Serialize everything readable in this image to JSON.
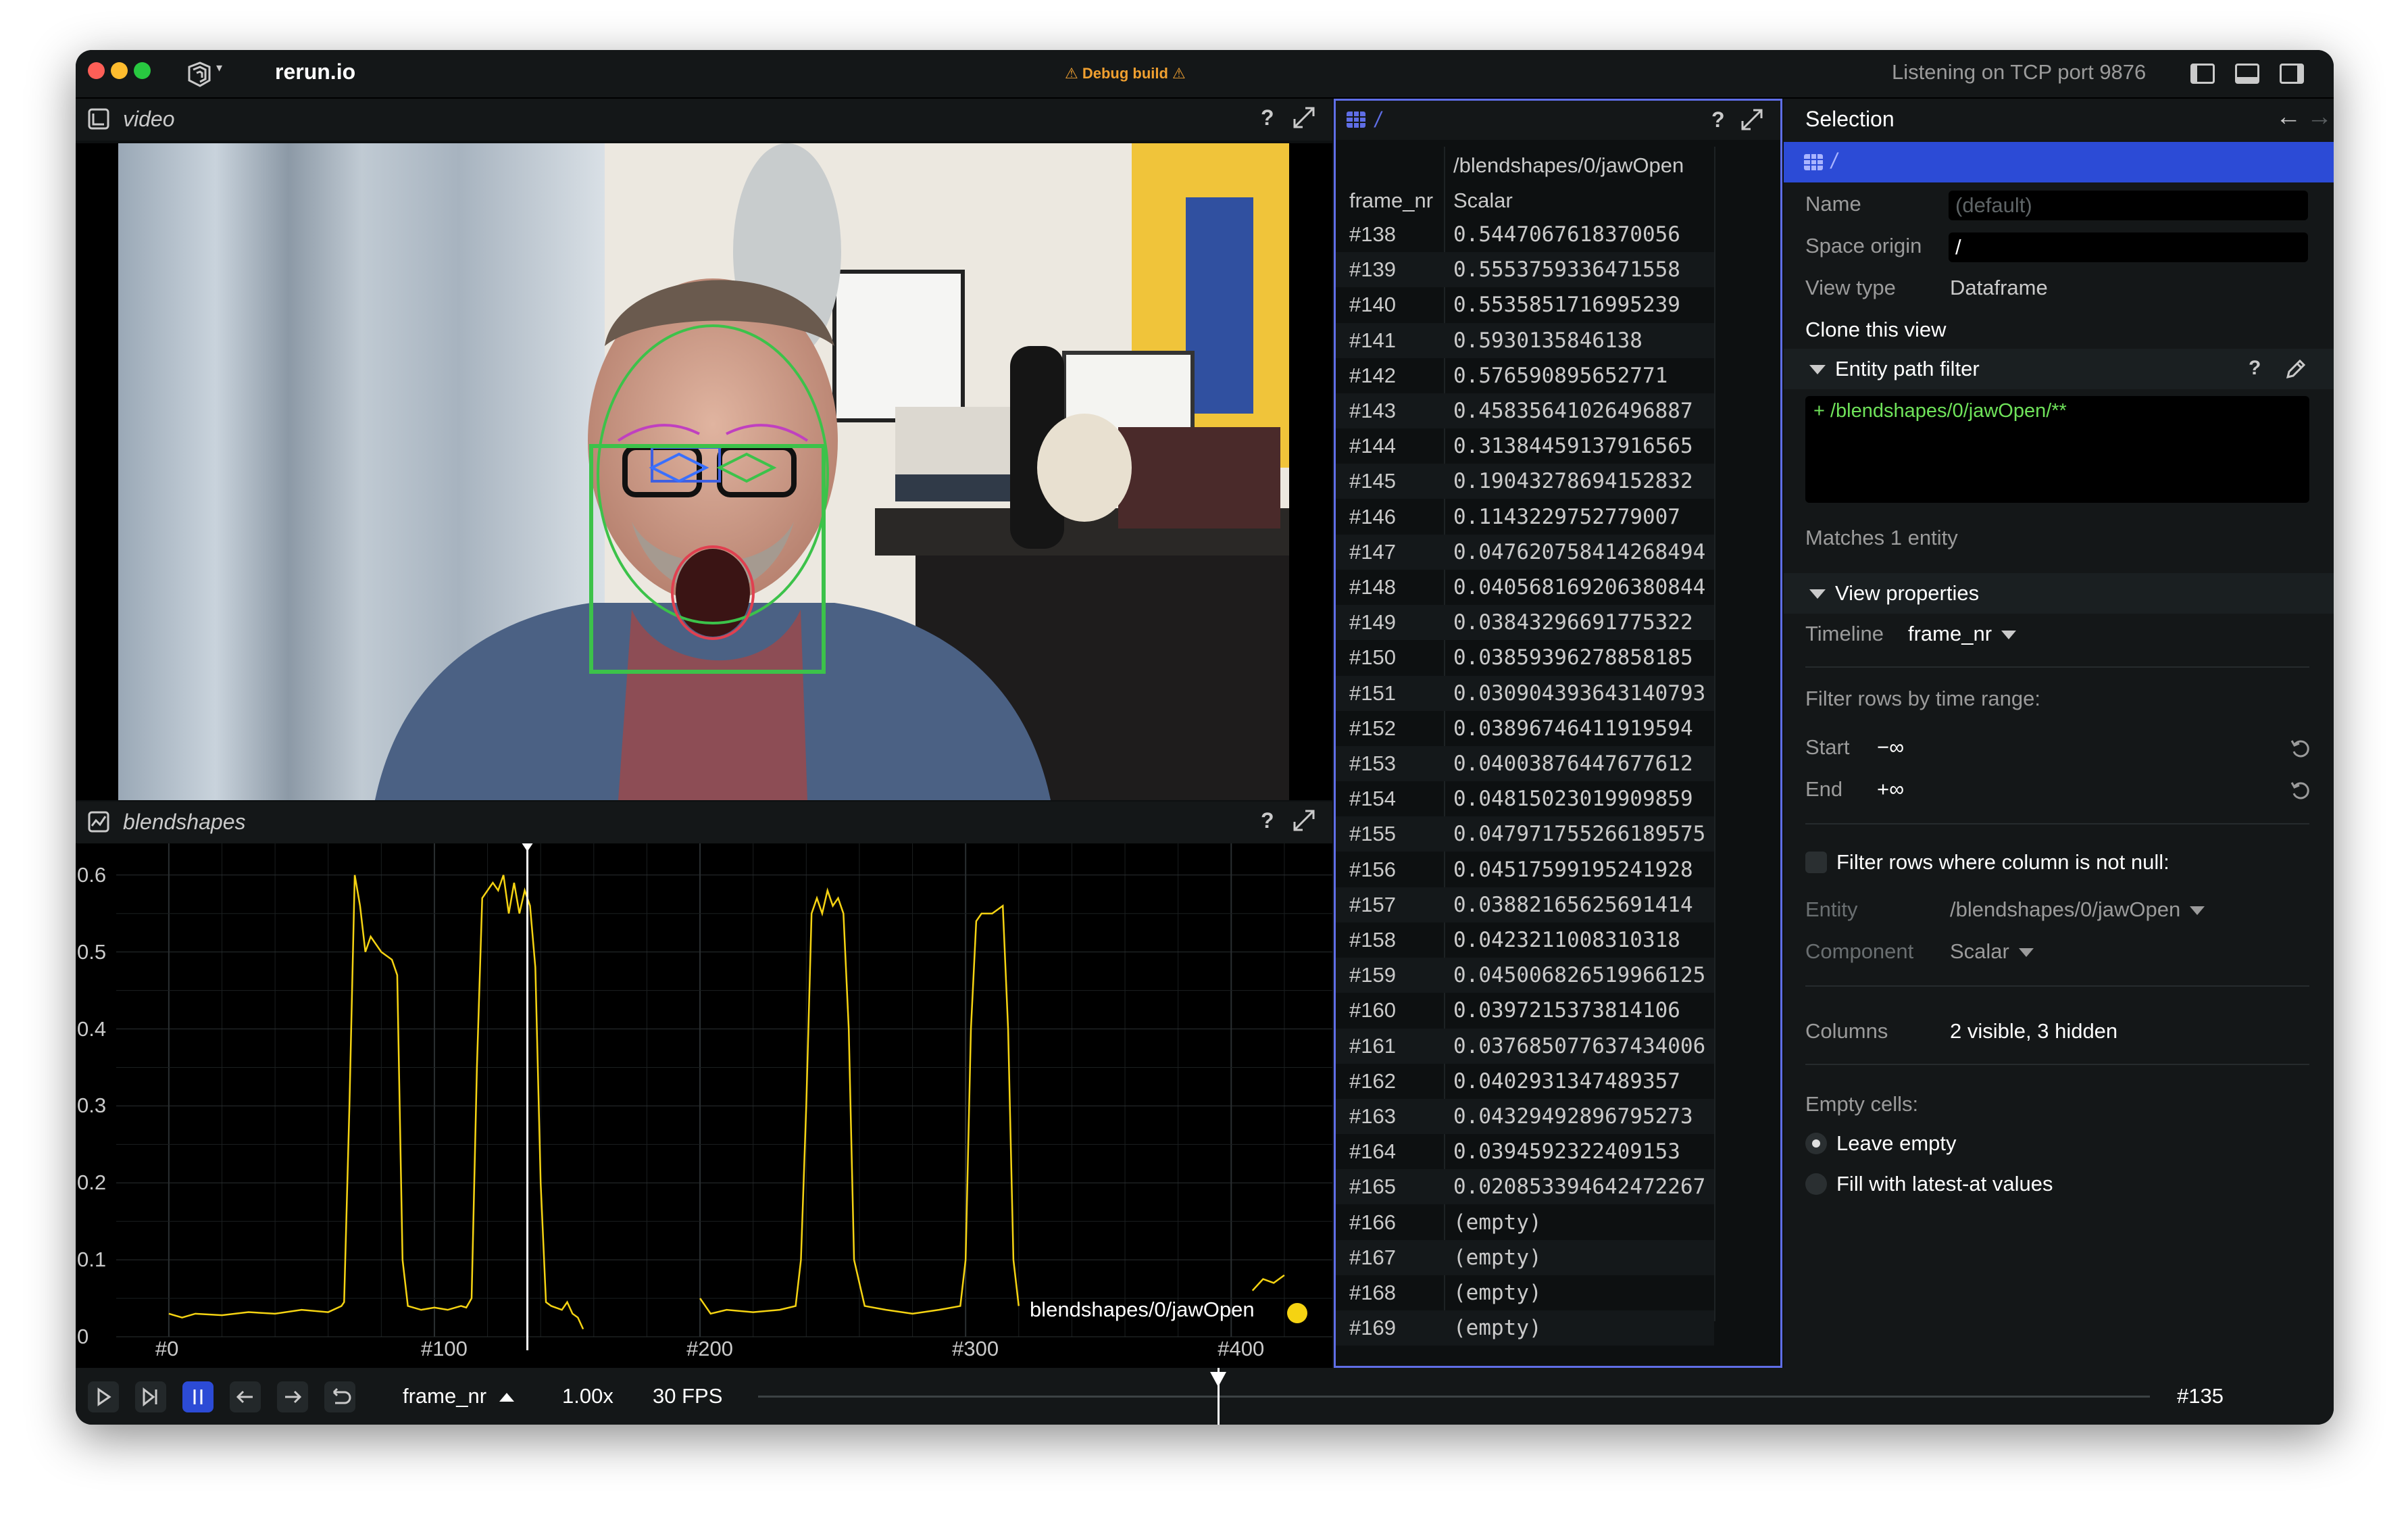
{
  "app": {
    "title": "rerun.io",
    "debug_label": "⚠ Debug build ⚠",
    "status": "Listening on TCP port 9876"
  },
  "colors": {
    "accent": "#2c4bd6",
    "series": "#f5d312",
    "face_box": "#3cc24a",
    "selection_border": "#5f6ee6"
  },
  "video_panel": {
    "title": "video",
    "help": "?"
  },
  "plot_panel": {
    "title": "blendshapes",
    "help": "?",
    "legend": "blendshapes/0/jawOpen"
  },
  "chart_data": {
    "type": "line",
    "title": "blendshapes",
    "xlabel": "",
    "ylabel": "",
    "xlim": [
      -2,
      433
    ],
    "ylim": [
      0,
      0.62
    ],
    "x_ticks": [
      "#0",
      "#100",
      "#200",
      "#300",
      "#400"
    ],
    "y_ticks": [
      "0",
      "0.1",
      "0.2",
      "0.3",
      "0.4",
      "0.5",
      "0.6"
    ],
    "time_cursor": 135,
    "grid": true,
    "legend_position": "bottom-right",
    "series": [
      {
        "name": "blendshapes/0/jawOpen",
        "points": [
          [
            0,
            0.03
          ],
          [
            5,
            0.025
          ],
          [
            10,
            0.03
          ],
          [
            20,
            0.028
          ],
          [
            30,
            0.032
          ],
          [
            40,
            0.03
          ],
          [
            50,
            0.035
          ],
          [
            60,
            0.032
          ],
          [
            65,
            0.04
          ],
          [
            66,
            0.045
          ],
          [
            68,
            0.3
          ],
          [
            70,
            0.6
          ],
          [
            72,
            0.56
          ],
          [
            74,
            0.5
          ],
          [
            76,
            0.52
          ],
          [
            80,
            0.5
          ],
          [
            84,
            0.49
          ],
          [
            86,
            0.47
          ],
          [
            88,
            0.1
          ],
          [
            90,
            0.04
          ],
          [
            95,
            0.035
          ],
          [
            100,
            0.038
          ],
          [
            105,
            0.035
          ],
          [
            110,
            0.04
          ],
          [
            112,
            0.038
          ],
          [
            114,
            0.05
          ],
          [
            116,
            0.35
          ],
          [
            118,
            0.57
          ],
          [
            122,
            0.59
          ],
          [
            124,
            0.58
          ],
          [
            126,
            0.6
          ],
          [
            128,
            0.55
          ],
          [
            130,
            0.59
          ],
          [
            132,
            0.55
          ],
          [
            134,
            0.58
          ],
          [
            136,
            0.56
          ],
          [
            138,
            0.48
          ],
          [
            140,
            0.2
          ],
          [
            142,
            0.045
          ],
          [
            144,
            0.04
          ],
          [
            148,
            0.035
          ],
          [
            150,
            0.045
          ],
          [
            152,
            0.03
          ],
          [
            154,
            0.025
          ],
          [
            156,
            0.01
          ]
        ],
        "points_b": [
          [
            200,
            0.05
          ],
          [
            204,
            0.03
          ],
          [
            210,
            0.035
          ],
          [
            220,
            0.032
          ],
          [
            230,
            0.035
          ],
          [
            236,
            0.04
          ],
          [
            238,
            0.1
          ],
          [
            240,
            0.3
          ],
          [
            242,
            0.55
          ],
          [
            244,
            0.57
          ],
          [
            246,
            0.55
          ],
          [
            248,
            0.58
          ],
          [
            250,
            0.56
          ],
          [
            252,
            0.57
          ],
          [
            254,
            0.55
          ],
          [
            256,
            0.4
          ],
          [
            258,
            0.1
          ],
          [
            262,
            0.04
          ],
          [
            270,
            0.035
          ],
          [
            280,
            0.03
          ],
          [
            290,
            0.035
          ],
          [
            298,
            0.04
          ],
          [
            300,
            0.1
          ],
          [
            302,
            0.4
          ],
          [
            304,
            0.54
          ],
          [
            306,
            0.55
          ],
          [
            310,
            0.55
          ],
          [
            314,
            0.56
          ],
          [
            316,
            0.4
          ],
          [
            318,
            0.1
          ],
          [
            320,
            0.04
          ]
        ],
        "points_c": [
          [
            408,
            0.06
          ],
          [
            412,
            0.075
          ],
          [
            416,
            0.07
          ],
          [
            420,
            0.08
          ]
        ]
      }
    ]
  },
  "dataframe_panel": {
    "path_header": "/blendshapes/0/jawOpen",
    "columns": [
      "frame_nr",
      "Scalar"
    ],
    "help": "?",
    "breadcrumb": "/",
    "rows": [
      [
        "#138",
        "0.5447067618370056"
      ],
      [
        "#139",
        "0.5553759336471558"
      ],
      [
        "#140",
        "0.5535851716995239"
      ],
      [
        "#141",
        "0.5930135846138"
      ],
      [
        "#142",
        "0.576590895652771"
      ],
      [
        "#143",
        "0.45835641026496887"
      ],
      [
        "#144",
        "0.31384459137916565"
      ],
      [
        "#145",
        "0.19043278694152832"
      ],
      [
        "#146",
        "0.1143229752779007"
      ],
      [
        "#147",
        "0.047620758414268494"
      ],
      [
        "#148",
        "0.040568169206380844"
      ],
      [
        "#149",
        "0.03843296691775322"
      ],
      [
        "#150",
        "0.03859396278858185"
      ],
      [
        "#151",
        "0.030904393643140793"
      ],
      [
        "#152",
        "0.03896746411919594"
      ],
      [
        "#153",
        "0.04003876447677612"
      ],
      [
        "#154",
        "0.04815023019909859"
      ],
      [
        "#155",
        "0.047971755266189575"
      ],
      [
        "#156",
        "0.04517599195241928"
      ],
      [
        "#157",
        "0.03882165625691414"
      ],
      [
        "#158",
        "0.0423211008310318"
      ],
      [
        "#159",
        "0.045006826519966125"
      ],
      [
        "#160",
        "0.0397215373814106"
      ],
      [
        "#161",
        "0.037685077637434006"
      ],
      [
        "#162",
        "0.0402931347489357"
      ],
      [
        "#163",
        "0.04329492896795273"
      ],
      [
        "#164",
        "0.0394592322409153"
      ],
      [
        "#165",
        "0.020853394642472267"
      ],
      [
        "#166",
        "(empty)"
      ],
      [
        "#167",
        "(empty)"
      ],
      [
        "#168",
        "(empty)"
      ],
      [
        "#169",
        "(empty)"
      ]
    ]
  },
  "selection": {
    "title": "Selection",
    "breadcrumb": "/",
    "name_label": "Name",
    "name_placeholder": "(default)",
    "space_origin_label": "Space origin",
    "space_origin_value": "/",
    "view_type_label": "View type",
    "view_type_value": "Dataframe",
    "clone_label": "Clone this view",
    "entity_filter_title": "Entity path filter",
    "entity_filter_help": "?",
    "entity_filter_value": "+ /blendshapes/0/jawOpen/**",
    "matches": "Matches 1 entity",
    "view_props_title": "View properties",
    "timeline_label": "Timeline",
    "timeline_value": "frame_nr",
    "filter_time_label": "Filter rows by time range:",
    "start_label": "Start",
    "start_value": "−∞",
    "end_label": "End",
    "end_value": "+∞",
    "not_null_label": "Filter rows where column is not null:",
    "entity_label": "Entity",
    "entity_value": "/blendshapes/0/jawOpen",
    "component_label": "Component",
    "component_value": "Scalar",
    "columns_label": "Columns",
    "columns_value": "2 visible, 3 hidden",
    "empty_cells_label": "Empty cells:",
    "leave_empty": "Leave empty",
    "fill_latest": "Fill with latest-at values"
  },
  "timebar": {
    "timeline": "frame_nr",
    "speed": "1.00x",
    "fps": "30 FPS",
    "current_frame": "#135",
    "playhead_fraction": 0.33
  }
}
